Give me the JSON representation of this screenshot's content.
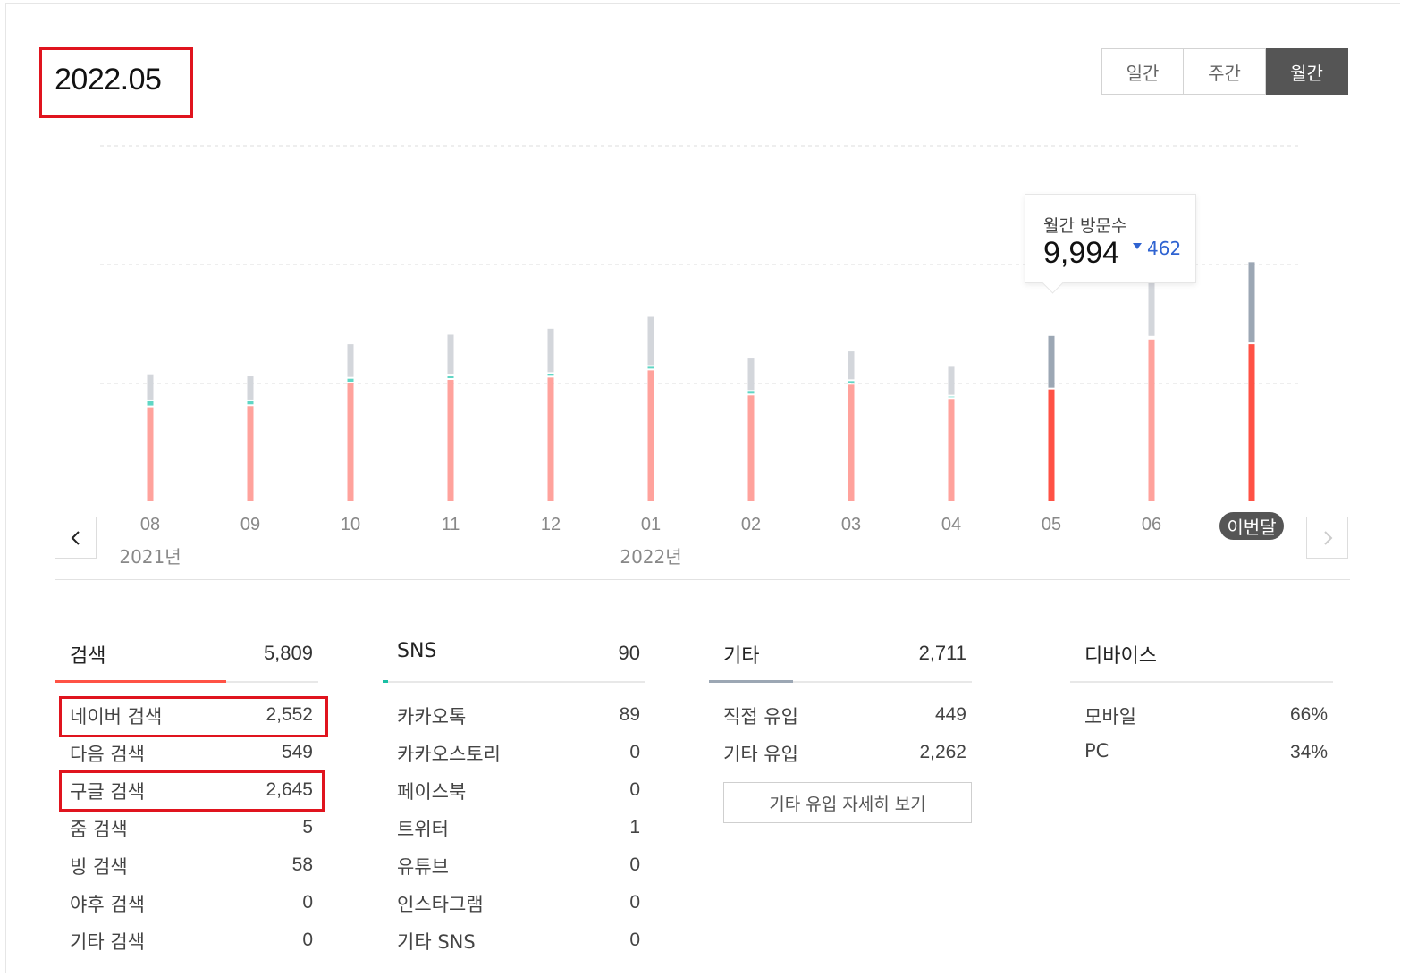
{
  "header": {
    "period": "2022.05",
    "tabs": [
      {
        "label": "일간",
        "active": false
      },
      {
        "label": "주간",
        "active": false
      },
      {
        "label": "월간",
        "active": true
      }
    ]
  },
  "chart_data": {
    "type": "bar",
    "stacked": true,
    "categories": [
      "08",
      "09",
      "10",
      "11",
      "12",
      "01",
      "02",
      "03",
      "04",
      "05",
      "06",
      "이번달"
    ],
    "year_labels": [
      {
        "category": "08",
        "label": "2021년"
      },
      {
        "category": "01",
        "label": "2022년"
      }
    ],
    "series": [
      {
        "color": "#ff5245",
        "values": [
          8000,
          8100,
          10000,
          10300,
          10500,
          11100,
          9000,
          9900,
          8700,
          9500,
          13700,
          13300
        ]
      },
      {
        "color": "#5fd6c4",
        "values": [
          500,
          400,
          400,
          300,
          300,
          300,
          300,
          300,
          200,
          0,
          150,
          0
        ]
      },
      {
        "color": "#9ca7b4",
        "values": [
          2200,
          2100,
          2900,
          3500,
          3800,
          4200,
          2800,
          2500,
          2500,
          4500,
          4700,
          6900
        ]
      }
    ],
    "ylim": [
      0,
      20000
    ],
    "gridlines": [
      10000,
      20000,
      30000
    ],
    "selected_index": 9,
    "current_index": 11,
    "grid": true
  },
  "tooltip": {
    "label": "월간 방문수",
    "value": "9,994",
    "delta": "462"
  },
  "stats": {
    "search": {
      "label": "검색",
      "total": "5,809",
      "accent": "#ff5245",
      "share": 0.65,
      "items": [
        {
          "label": "네이버 검색",
          "value": "2,552"
        },
        {
          "label": "다음 검색",
          "value": "549"
        },
        {
          "label": "구글 검색",
          "value": "2,645"
        },
        {
          "label": "줌 검색",
          "value": "5"
        },
        {
          "label": "빙 검색",
          "value": "58"
        },
        {
          "label": "야후 검색",
          "value": "0"
        },
        {
          "label": "기타 검색",
          "value": "0"
        }
      ]
    },
    "sns": {
      "label": "SNS",
      "total": "90",
      "accent": "#1bbfa4",
      "share": 0.01,
      "items": [
        {
          "label": "카카오톡",
          "value": "89"
        },
        {
          "label": "카카오스토리",
          "value": "0"
        },
        {
          "label": "페이스북",
          "value": "0"
        },
        {
          "label": "트위터",
          "value": "1"
        },
        {
          "label": "유튜브",
          "value": "0"
        },
        {
          "label": "인스타그램",
          "value": "0"
        },
        {
          "label": "기타 SNS",
          "value": "0"
        }
      ]
    },
    "etc": {
      "label": "기타",
      "total": "2,711",
      "accent": "#9ca7b4",
      "share": 0.32,
      "items": [
        {
          "label": "직접 유입",
          "value": "449"
        },
        {
          "label": "기타 유입",
          "value": "2,262"
        }
      ],
      "detail_button": "기타 유입 자세히 보기"
    },
    "device": {
      "label": "디바이스",
      "items": [
        {
          "label": "모바일",
          "value": "66%"
        },
        {
          "label": "PC",
          "value": "34%"
        }
      ]
    }
  }
}
